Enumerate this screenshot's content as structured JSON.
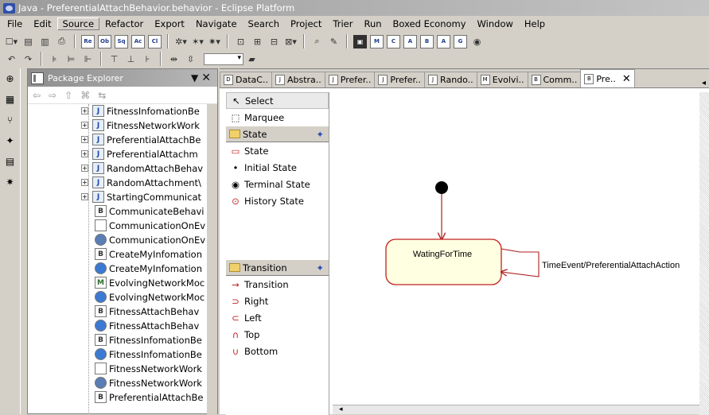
{
  "window": {
    "title": "Java - PreferentialAttachBehavior.behavior - Eclipse Platform"
  },
  "menu": [
    "File",
    "Edit",
    "Source",
    "Refactor",
    "Export",
    "Navigate",
    "Search",
    "Project",
    "Trier",
    "Run",
    "Boxed Economy",
    "Window",
    "Help"
  ],
  "menu_active": "Source",
  "toolbar1": [
    "Re",
    "Ob",
    "Sq",
    "Ac",
    "Cl"
  ],
  "toolbar2_icons": [
    "new-icon",
    "save-icon",
    "print-icon"
  ],
  "explorer": {
    "title": "Package Explorer",
    "rows": [
      {
        "label": "FitnessInfomationBe",
        "icon": "J",
        "type": "j",
        "exp": "+"
      },
      {
        "label": "FitnessNetworkWork",
        "icon": "J",
        "type": "j",
        "exp": "+"
      },
      {
        "label": "PreferentialAttachBe",
        "icon": "J",
        "type": "j",
        "exp": "+"
      },
      {
        "label": "PreferentialAttachm",
        "icon": "J",
        "type": "j",
        "exp": "+"
      },
      {
        "label": "RandomAttachBehav",
        "icon": "J",
        "type": "j",
        "exp": "+"
      },
      {
        "label": "RandomAttachment\\",
        "icon": "J",
        "type": "j",
        "exp": "+"
      },
      {
        "label": "StartingCommunicat",
        "icon": "J",
        "type": "j",
        "exp": "+"
      },
      {
        "label": "CommunicateBehavi",
        "icon": "B",
        "type": "b",
        "exp": ""
      },
      {
        "label": "CommunicationOnEv",
        "icon": "",
        "type": "f",
        "exp": ""
      },
      {
        "label": "CommunicationOnEv",
        "icon": "",
        "type": "e",
        "exp": ""
      },
      {
        "label": "CreateMyInfomation",
        "icon": "B",
        "type": "b",
        "exp": ""
      },
      {
        "label": "CreateMyInfomation",
        "icon": "",
        "type": "g",
        "exp": ""
      },
      {
        "label": "EvolvingNetworkMoc",
        "icon": "M",
        "type": "m",
        "exp": ""
      },
      {
        "label": "EvolvingNetworkMoc",
        "icon": "",
        "type": "g",
        "exp": ""
      },
      {
        "label": "FitnessAttachBehav",
        "icon": "B",
        "type": "b",
        "exp": ""
      },
      {
        "label": "FitnessAttachBehav",
        "icon": "",
        "type": "g",
        "exp": ""
      },
      {
        "label": "FitnessInfomationBe",
        "icon": "B",
        "type": "b",
        "exp": ""
      },
      {
        "label": "FitnessInfomationBe",
        "icon": "",
        "type": "g",
        "exp": ""
      },
      {
        "label": "FitnessNetworkWork",
        "icon": "",
        "type": "f",
        "exp": ""
      },
      {
        "label": "FitnessNetworkWork",
        "icon": "",
        "type": "e",
        "exp": ""
      },
      {
        "label": "PreferentialAttachBe",
        "icon": "B",
        "type": "b",
        "exp": ""
      }
    ]
  },
  "tabs": [
    {
      "label": "DataC..",
      "icon": "D"
    },
    {
      "label": "Abstra..",
      "icon": "J"
    },
    {
      "label": "Prefer..",
      "icon": "J"
    },
    {
      "label": "Prefer..",
      "icon": "J"
    },
    {
      "label": "Rando..",
      "icon": "J"
    },
    {
      "label": "Evolvi..",
      "icon": "M"
    },
    {
      "label": "Comm..",
      "icon": "B"
    },
    {
      "label": "Pre..",
      "icon": "B",
      "active": true
    }
  ],
  "palette": {
    "tools": [
      "Select",
      "Marquee"
    ],
    "state_drawer": {
      "label": "State",
      "items": [
        "State",
        "Initial State",
        "Terminal State",
        "History State"
      ]
    },
    "transition_drawer": {
      "label": "Transition",
      "items": [
        "Transition",
        "Right",
        "Left",
        "Top",
        "Bottom"
      ]
    }
  },
  "diagram": {
    "state_name": "WatingForTime",
    "self_transition": "TimeEvent/PreferentialAttachAction"
  }
}
